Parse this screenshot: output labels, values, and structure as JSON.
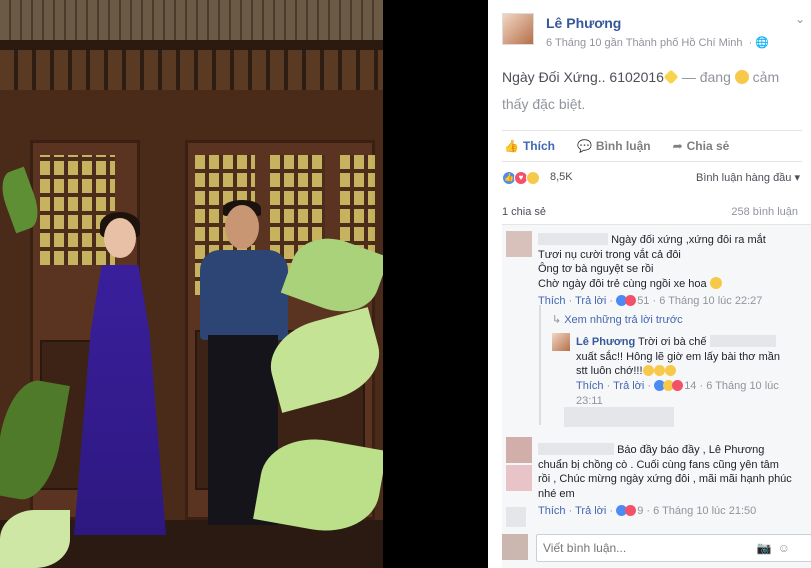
{
  "post": {
    "author": "Lê Phương",
    "meta_date": "6 Tháng 10 gần Thành phố Hồ Chí Minh",
    "meta_separator": "·",
    "text": "Ngày Đối Xứng.. 6102016",
    "feeling_prefix": "— đang",
    "feeling_text": "cảm thấy đặc biệt."
  },
  "actions": {
    "like": "Thích",
    "comment": "Bình luận",
    "share": "Chia sẻ"
  },
  "reactions": {
    "count": "8,5K",
    "ranking": "Bình luận hàng đầu ▾"
  },
  "counts": {
    "shares": "1 chia sẻ",
    "comments": "258 bình luận"
  },
  "comments": [
    {
      "lines": [
        "Ngày đối xứng ,xứng đôi ra mắt",
        "Tươi nụ cười trong vắt cả đôi",
        "Ông tơ bà nguyệt se rồi",
        "Chờ ngày đôi trẻ cùng ngồi xe hoa"
      ],
      "like": "Thích",
      "reply": "Trả lời",
      "reaction_count": "51",
      "time": "6 Tháng 10 lúc 22:27"
    },
    {
      "lines": [
        "Báo đầy báo đầy , Lê Phương",
        "chuẩn bị chồng cò . Cuối cùng fans cũng yên tâm",
        "rồi , Chúc mừng ngày xứng đôi , mãi mãi hạnh phúc",
        "nhé em"
      ],
      "like": "Thích",
      "reply": "Trả lời",
      "reaction_count": "9",
      "time": "6 Tháng 10 lúc 21:50"
    }
  ],
  "view_replies": "Xem những trả lời trước",
  "reply": {
    "author": "Lê Phương",
    "lines": [
      "Trời ơi bà chế",
      "xuất sắc!! Hông lẽ giờ em lấy bài thơ mần",
      "stt luôn chớ!!!"
    ],
    "like": "Thích",
    "reply": "Trả lời",
    "reaction_count": "14",
    "time": "6 Tháng 10 lúc",
    "time2": "23:11"
  },
  "composer": {
    "placeholder": "Viết bình luận..."
  },
  "icons": {
    "caret": "chevron-down-icon",
    "globe": "globe-icon",
    "like": "thumb-up-icon",
    "comment": "speech-bubble-icon",
    "share": "share-arrow-icon",
    "camera": "camera-icon",
    "emoji": "smiley-icon"
  }
}
